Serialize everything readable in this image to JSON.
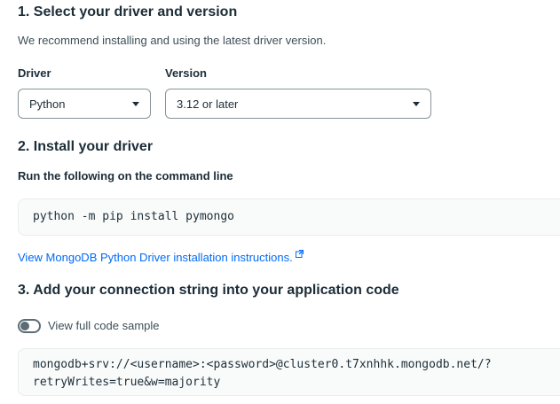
{
  "step1": {
    "title": "1. Select your driver and version",
    "subtitle": "We recommend installing and using the latest driver version.",
    "driver_label": "Driver",
    "driver_value": "Python",
    "version_label": "Version",
    "version_value": "3.12 or later"
  },
  "step2": {
    "title": "2. Install your driver",
    "instruction": "Run the following on the command line",
    "command": "python -m pip install pymongo",
    "link_text": "View MongoDB Python Driver installation instructions."
  },
  "step3": {
    "title": "3. Add your connection string into your application code",
    "toggle_label": "View full code sample",
    "connection_line1": "mongodb+srv://<username>:<password>@cluster0.t7xnhhk.mongodb.net/?",
    "connection_line2": "retryWrites=true&w=majority"
  },
  "colors": {
    "link": "#016bf8",
    "text": "#1c2d38",
    "code_bg": "#f9fbfa"
  }
}
